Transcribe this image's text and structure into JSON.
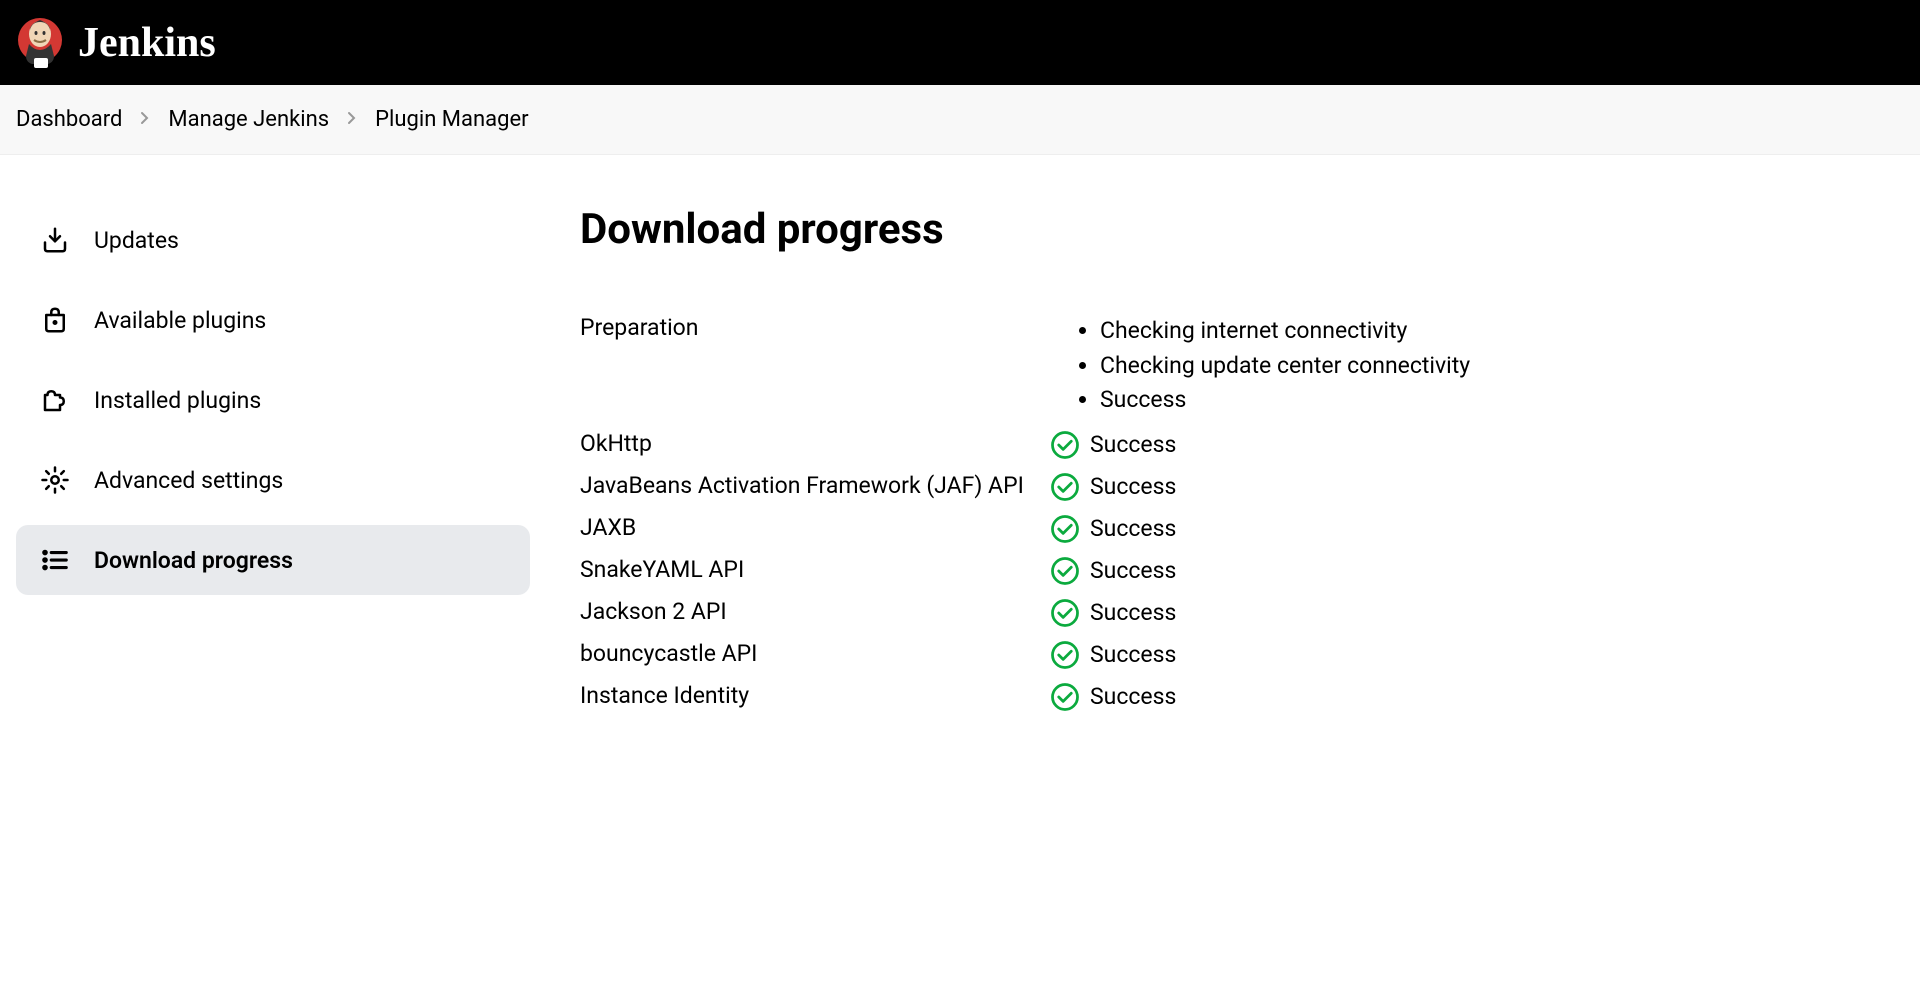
{
  "header": {
    "brand": "Jenkins"
  },
  "breadcrumbs": [
    {
      "label": "Dashboard"
    },
    {
      "label": "Manage Jenkins"
    },
    {
      "label": "Plugin Manager"
    }
  ],
  "sidebar": {
    "items": [
      {
        "label": "Updates",
        "icon": "download-icon",
        "active": false
      },
      {
        "label": "Available plugins",
        "icon": "bag-icon",
        "active": false
      },
      {
        "label": "Installed plugins",
        "icon": "puzzle-icon",
        "active": false
      },
      {
        "label": "Advanced settings",
        "icon": "gear-icon",
        "active": false
      },
      {
        "label": "Download progress",
        "icon": "list-icon",
        "active": true
      }
    ]
  },
  "main": {
    "title": "Download progress",
    "preparation": {
      "label": "Preparation",
      "steps": [
        "Checking internet connectivity",
        "Checking update center connectivity",
        "Success"
      ]
    },
    "plugins": [
      {
        "name": "OkHttp",
        "status": "Success"
      },
      {
        "name": "JavaBeans Activation Framework (JAF) API",
        "status": "Success"
      },
      {
        "name": "JAXB",
        "status": "Success"
      },
      {
        "name": "SnakeYAML API",
        "status": "Success"
      },
      {
        "name": "Jackson 2 API",
        "status": "Success"
      },
      {
        "name": "bouncycastle API",
        "status": "Success"
      },
      {
        "name": "Instance Identity",
        "status": "Success"
      }
    ],
    "successLabel": "Success"
  },
  "colors": {
    "successGreen": "#0baa3e"
  }
}
